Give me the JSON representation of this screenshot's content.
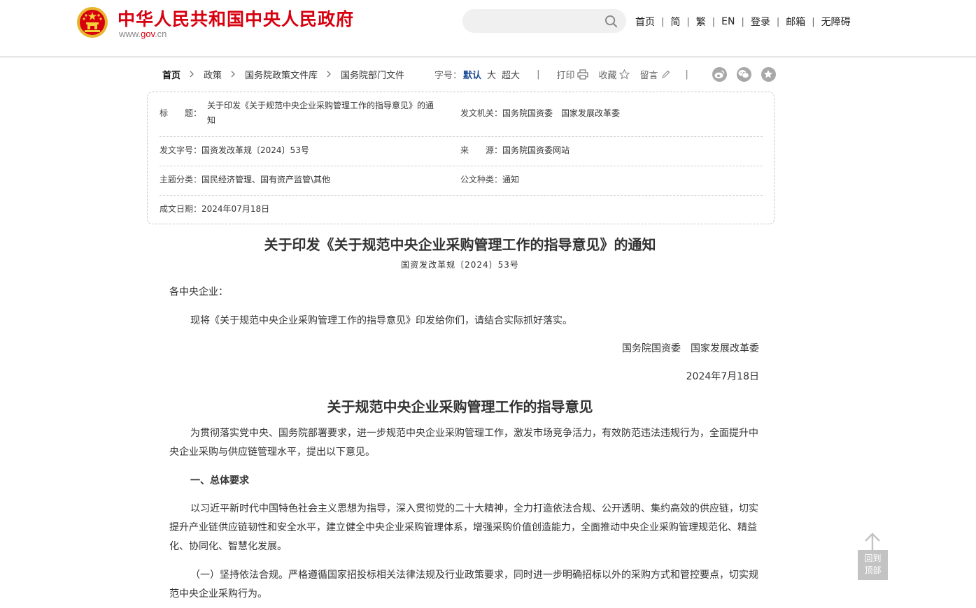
{
  "header": {
    "site_title": "中华人民共和国中央人民政府",
    "url_prefix": "www.",
    "url_domain": "gov",
    "url_suffix": ".cn",
    "search": {
      "value": "",
      "placeholder": ""
    },
    "nav": [
      "首页",
      "简",
      "繁",
      "EN",
      "登录",
      "邮箱",
      "无障碍"
    ]
  },
  "breadcrumb": [
    "首页",
    "政策",
    "国务院政策文件库",
    "国务院部门文件"
  ],
  "toolbar": {
    "font_label": "字号：",
    "font_sizes": [
      "默认",
      "大",
      "超大"
    ],
    "separator": "|",
    "print": "打印",
    "favorite": "收藏",
    "comment": "留言"
  },
  "share_icons": [
    "weibo-icon",
    "wechat-icon",
    "star-icon"
  ],
  "meta": {
    "title_label": "标　　题：",
    "title_line1": "关于印发《关于规范中央企业采购管理工作的指导意见》的通",
    "title_line2": "知",
    "issuer_label": "发文机关：",
    "issuer": "国务院国资委　国家发展改革委",
    "doc_no_label": "发文字号：",
    "doc_no": "国资发改革规〔2024〕53号",
    "source_label": "来　　源：",
    "source": "国务院国资委网站",
    "topic_label": "主题分类：",
    "topic": "国民经济管理、国有资产监管\\其他",
    "type_label": "公文种类：",
    "type": "通知",
    "date_label": "成文日期：",
    "date": "2024年07月18日"
  },
  "article": {
    "title": "关于印发《关于规范中央企业采购管理工作的指导意见》的通知",
    "doc_no": "国资发改革规〔2024〕53号",
    "salutation": "各中央企业：",
    "intro": "现将《关于规范中央企业采购管理工作的指导意见》印发给你们，请结合实际抓好落实。",
    "signatories": "国务院国资委　国家发展改革委",
    "sign_date": "2024年7月18日",
    "subtitle": "关于规范中央企业采购管理工作的指导意见",
    "para1": "为贯彻落实党中央、国务院部署要求，进一步规范中央企业采购管理工作，激发市场竞争活力，有效防范违法违规行为，全面提升中央企业采购与供应链管理水平，提出以下意见。",
    "section1": "一、总体要求",
    "para2": "以习近平新时代中国特色社会主义思想为指导，深入贯彻党的二十大精神，全力打造依法合规、公开透明、集约高效的供应链，切实提升产业链供应链韧性和安全水平，建立健全中央企业采购管理体系，增强采购价值创造能力，全面推动中央企业采购管理规范化、精益化、协同化、智慧化发展。",
    "para3": "（一）坚持依法合规。严格遵循国家招投标相关法律法规及行业政策要求，同时进一步明确招标以外的采购方式和管控要点，切实规范中央企业采购行为。"
  },
  "back_to_top": {
    "line1": "回到",
    "line2": "顶部"
  },
  "colors": {
    "brand_red": "#d7000f",
    "active_blue": "#1f4e96",
    "icon_gray": "#a8a8a8"
  }
}
